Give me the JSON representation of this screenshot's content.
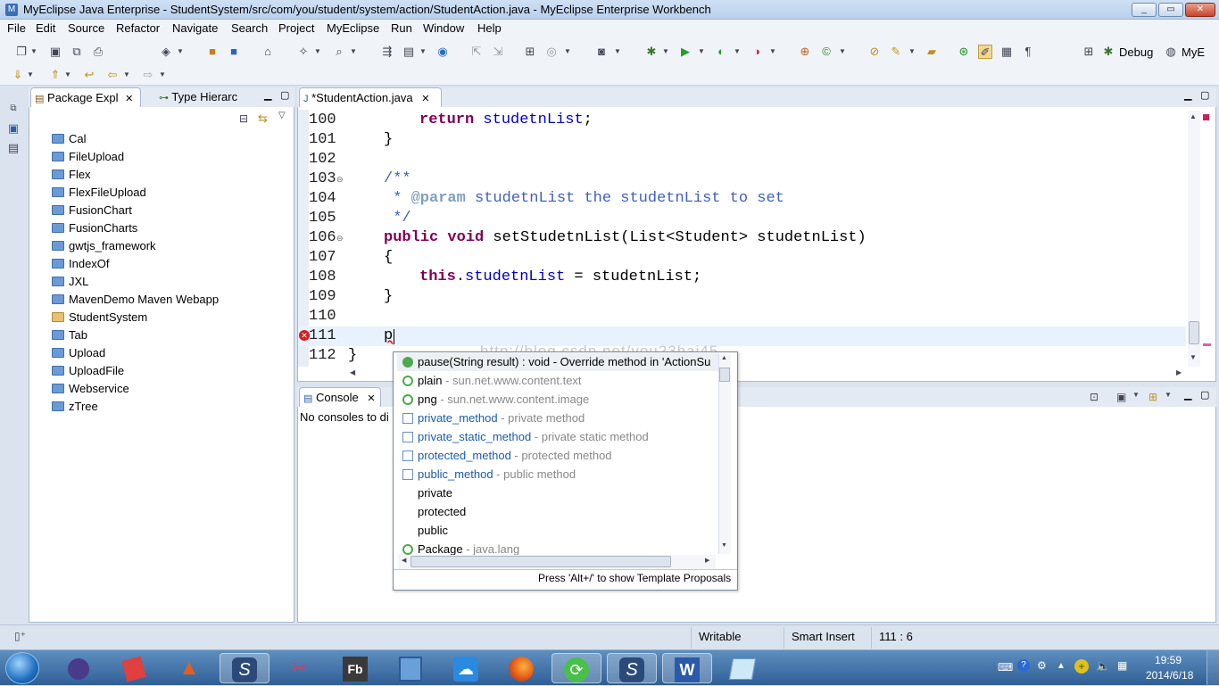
{
  "window": {
    "title": "MyEclipse Java Enterprise - StudentSystem/src/com/you/student/system/action/StudentAction.java - MyEclipse Enterprise Workbench"
  },
  "menu": [
    "File",
    "Edit",
    "Source",
    "Refactor",
    "Navigate",
    "Search",
    "Project",
    "MyEclipse",
    "Run",
    "Window",
    "Help"
  ],
  "perspectives": {
    "debug": "Debug",
    "mye": "MyE"
  },
  "package_explorer": {
    "tabs": [
      "Package Expl",
      "Type Hierarc"
    ],
    "items": [
      "Cal",
      "FileUpload",
      "Flex",
      "FlexFileUpload",
      "FusionChart",
      "FusionCharts",
      "gwtjs_framework",
      "IndexOf",
      "JXL",
      "MavenDemo Maven Webapp",
      "StudentSystem",
      "Tab",
      "Upload",
      "UploadFile",
      "Webservice",
      "zTree"
    ]
  },
  "editor": {
    "tab": "*StudentAction.java",
    "lines": [
      {
        "n": "100",
        "code": "return studetnList;"
      },
      {
        "n": "101",
        "code": "}"
      },
      {
        "n": "102",
        "code": ""
      },
      {
        "n": "103",
        "code": "/**"
      },
      {
        "n": "104",
        "code": " * @param studetnList the studetnList to set"
      },
      {
        "n": "105",
        "code": " */"
      },
      {
        "n": "106",
        "code": "public void setStudetnList(List<Student> studetnList)"
      },
      {
        "n": "107",
        "code": "{"
      },
      {
        "n": "108",
        "code": "this.studetnList = studetnList;"
      },
      {
        "n": "109",
        "code": "}"
      },
      {
        "n": "110",
        "code": ""
      },
      {
        "n": "111",
        "code": "p"
      },
      {
        "n": "112",
        "code": "}"
      }
    ],
    "watermark": "http://blog.csdn.net/you23hai45"
  },
  "console": {
    "tab": "Console",
    "text": "No consoles to di"
  },
  "autocomplete": {
    "items": [
      {
        "main": "pause(String result) : void - Override method in 'ActionSu",
        "sub": "",
        "icon": "pub"
      },
      {
        "main": "plain",
        "sub": " - sun.net.www.content.text",
        "icon": "pubc"
      },
      {
        "main": "png",
        "sub": " - sun.net.www.content.image",
        "icon": "pubc"
      },
      {
        "main": "private_method",
        "sub": " - private method",
        "icon": "tpl"
      },
      {
        "main": "private_static_method",
        "sub": " - private static method",
        "icon": "tpl"
      },
      {
        "main": "protected_method",
        "sub": " - protected method",
        "icon": "tpl"
      },
      {
        "main": "public_method",
        "sub": " - public method",
        "icon": "tpl"
      },
      {
        "main": "private",
        "sub": "",
        "icon": "none"
      },
      {
        "main": "protected",
        "sub": "",
        "icon": "none"
      },
      {
        "main": "public",
        "sub": "",
        "icon": "none"
      },
      {
        "main": "Package",
        "sub": " - java.lang",
        "icon": "pubc"
      }
    ],
    "footer": "Press 'Alt+/' to show Template Proposals"
  },
  "status": {
    "writable": "Writable",
    "insert": "Smart Insert",
    "position": "111 : 6"
  },
  "clock": {
    "time": "19:59",
    "date": "2014/6/18"
  },
  "taskbar": {
    "fb": "Fb"
  }
}
